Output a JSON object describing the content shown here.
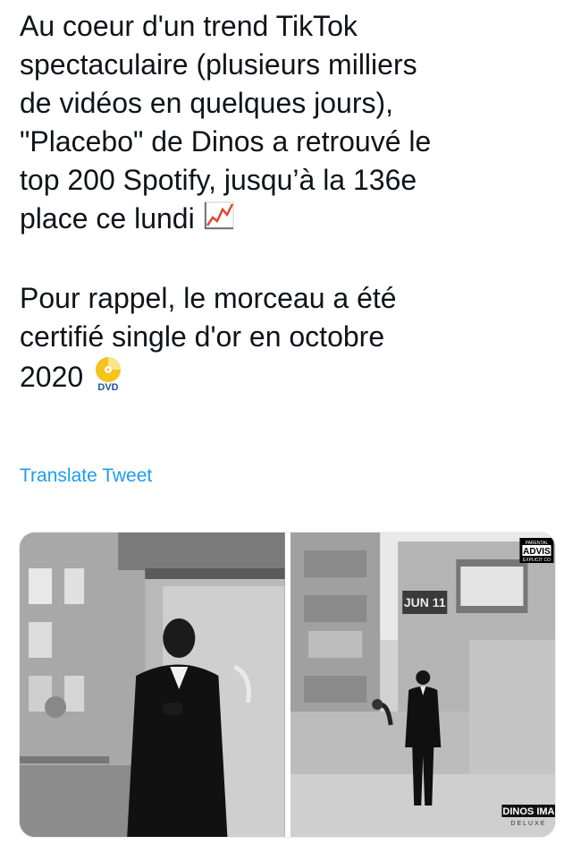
{
  "tweet": {
    "lines": [
      "Au coeur d'un trend TikTok",
      "spectaculaire (plusieurs milliers",
      "de vidéos en quelques jours),",
      "\"Placebo\" de Dinos a retrouvé le",
      "top 200 Spotify, jusqu’à la 136e",
      "place ce lundi"
    ],
    "lines2": [
      "Pour rappel, le morceau a été",
      "certifié single d'or en octobre",
      "2020"
    ],
    "emoji_chart": "chart-increasing-icon",
    "emoji_dvd": "dvd-icon",
    "dvd_label": "DVD"
  },
  "translate_label": "Translate Tweet",
  "media": {
    "photo1": "man-in-suit-photo",
    "photo2": "album-cover-photo",
    "cover_sign": "JUN 11",
    "advisory_top": "PARENTAL",
    "advisory_mid": "ADVIS",
    "advisory_bottom": "EXPLICIT CO",
    "cover_title": "DINOS IMA",
    "cover_sub": "DELUXE"
  }
}
